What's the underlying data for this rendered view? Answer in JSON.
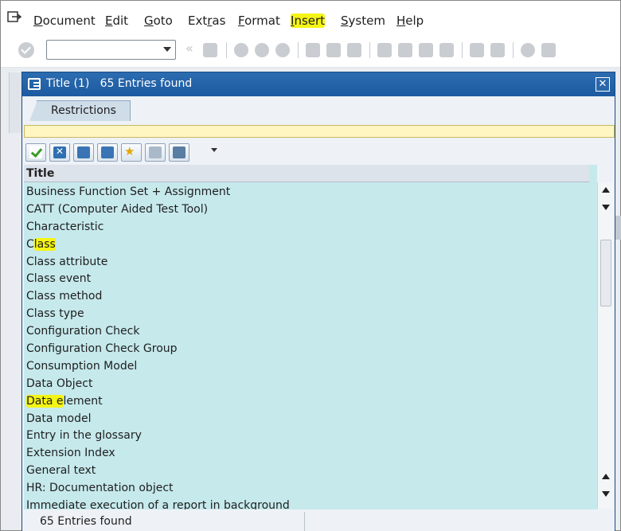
{
  "menu": {
    "items": [
      {
        "label": "Document",
        "accel": "D"
      },
      {
        "label": "Edit",
        "accel": "E"
      },
      {
        "label": "Goto",
        "accel": "G"
      },
      {
        "label": "Extras",
        "accel": "r"
      },
      {
        "label": "Format",
        "accel": "F"
      },
      {
        "label": "Insert",
        "accel": "I"
      },
      {
        "label": "System",
        "accel": "S"
      },
      {
        "label": "Help",
        "accel": "H"
      }
    ]
  },
  "toolbar": {
    "command_field_value": "",
    "icons": [
      "enter-icon",
      "save-icon",
      "back-icon",
      "exit-icon",
      "cancel-icon",
      "print-icon",
      "find-icon",
      "find-next-icon",
      "first-page-icon",
      "previous-page-icon",
      "next-page-icon",
      "last-page-icon",
      "create-session-icon",
      "shortcut-icon",
      "help-icon",
      "customize-layout-icon"
    ]
  },
  "dialog": {
    "title": "Title (1)   65 Entries found",
    "tab_label": "Restrictions",
    "list_header": "Title",
    "entries": [
      "Business Function Set + Assignment",
      "CATT (Computer Aided Test Tool)",
      "Characteristic",
      "Class",
      "Class attribute",
      "Class event",
      "Class method",
      "Class type",
      "Configuration Check",
      "Configuration Check Group",
      "Consumption Model",
      "Data Object",
      "Data element",
      "Data model",
      "Entry in the glossary",
      "Extension Index",
      "General text",
      "HR: Documentation object",
      "Immediate execution of a report in background"
    ],
    "status_text": "65 Entries found"
  },
  "colors": {
    "title_bar": "#1d5aa1",
    "list_background": "#c6e9ec",
    "highlight": "#f5f515",
    "message_bar": "#fff6c2"
  }
}
